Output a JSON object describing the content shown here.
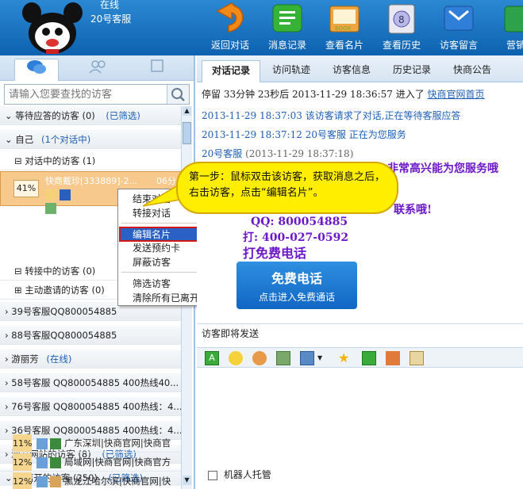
{
  "header": {
    "status": "在线",
    "agent": "20号客服"
  },
  "toolbar": [
    {
      "label": "返回对话",
      "icon": "back-arrow-icon"
    },
    {
      "label": "消息记录",
      "icon": "message-record-icon"
    },
    {
      "label": "查看名片",
      "icon": "view-card-icon"
    },
    {
      "label": "查看历史",
      "icon": "history-icon"
    },
    {
      "label": "访客留言",
      "icon": "visitor-message-icon"
    },
    {
      "label": "营销",
      "icon": "marketing-icon"
    }
  ],
  "search": {
    "placeholder": "请输入您要查找的访客"
  },
  "groups": {
    "waiting": {
      "label": "等待应答的访客 (0)",
      "filter": "(已筛选)"
    },
    "self": {
      "label": "自己",
      "count": "(1个对话中)"
    },
    "chatting": {
      "label": "对话中的访客 (1)"
    },
    "visitor": {
      "percent": "41%",
      "name": "快商戴珍[333889]-2...",
      "time": "06分"
    },
    "transferring": {
      "label": "转接中的访客 (0)"
    },
    "invited": {
      "label": "主动邀请的访客 (0)"
    },
    "agent39": {
      "label": "39号客服QQ800054885"
    },
    "agent88": {
      "label": "88号客服QQ800054885"
    },
    "youlifang": {
      "label": "游丽芳",
      "status": "(在线)"
    },
    "agent58": {
      "label": "58号客服 QQ800054885    400热线40..."
    },
    "agent76": {
      "label": "76号客服 QQ800054885    400热线：4..."
    },
    "agent36": {
      "label": "36号客服 QQ800054885    400热线：4..."
    },
    "browsing": {
      "label": "浏览网站的访客 (8)",
      "filter": "(已筛选)"
    },
    "left": {
      "label": "已离开的访客 (250)",
      "filter": "(已筛选)"
    }
  },
  "left_visitors": [
    {
      "percent": "11%",
      "text": "广东深圳|快商官网|快商官"
    },
    {
      "percent": "12%",
      "text": "局域网|快商官网|快商官方"
    },
    {
      "percent": "12%",
      "text": "黑龙江哈尔滨|快商官网|快"
    }
  ],
  "context_menu": [
    "结束对话",
    "转接对话",
    "编辑名片",
    "发送预约卡",
    "屏蔽访客",
    "筛选访客",
    "清除所有已离开的访客"
  ],
  "tabs": [
    "对话记录",
    "访问轨迹",
    "访客信息",
    "历史记录",
    "快商公告"
  ],
  "chat": {
    "line1": "停留 33分钟 23秒后 2013-11-29 18:36:57 进入了",
    "link": "快商官网首页",
    "line2": "2013-11-29 18:37:03 该访客请求了对话,正在等待客服应答",
    "line3": "2013-11-29 18:37:12 20号客服 正在为您服务",
    "line4_name": "20号客服",
    "line4_time": "(2013-11-29 18:37:18)",
    "msg1": "非常高兴能为您服务哦",
    "msg2": "联系哦!",
    "msg3": "QQ: 800054885",
    "msg4": "打: 400-027-0592",
    "msg5": "打免费电话",
    "call_title": "免费电话",
    "call_sub": "点击进入免费通话"
  },
  "pending": "访客即将发送",
  "robot": "机器人托管",
  "callout": "第一步：鼠标双击该访客，获取消息之后，右击访客，点击“编辑名片”。"
}
